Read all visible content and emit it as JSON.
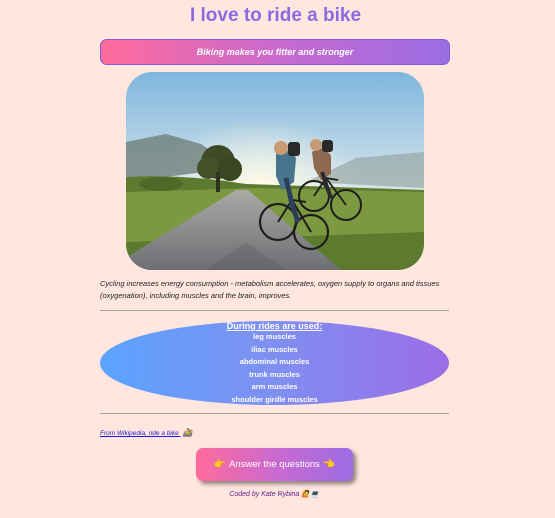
{
  "header": {
    "title": "I love to ride a bike",
    "subtitle": "Biking makes you fitter and stronger"
  },
  "photo": {
    "alt": "Two cyclists riding on a road at sunrise"
  },
  "description": "Cycling increases energy consumption - metabolism accelerates, oxygen supply to organs and tissues (oxygenation), including muscles and the brain, improves.",
  "muscles": {
    "heading": "During rides are used:",
    "items": [
      "leg muscles",
      "iliac muscles",
      "abdominal muscles",
      "trunk muscles",
      "arm muscles",
      "shoulder girdle muscles"
    ]
  },
  "source_link": {
    "label": "From Wikipedia, ride a bike",
    "icon": "🚵"
  },
  "answer_button": {
    "icon_left": "👉",
    "label": "Answer the questions",
    "icon_right": "👈"
  },
  "footer": {
    "credit": "Coded by Kate Rybina",
    "icons": "🙋💻"
  },
  "colors": {
    "background": "#ffe6df",
    "title": "#8a6be0",
    "gradient_pink": "#ff6b9b",
    "gradient_purple": "#9a6de3",
    "gradient_blue": "#5aa4ff",
    "link": "#1a1ad6"
  }
}
